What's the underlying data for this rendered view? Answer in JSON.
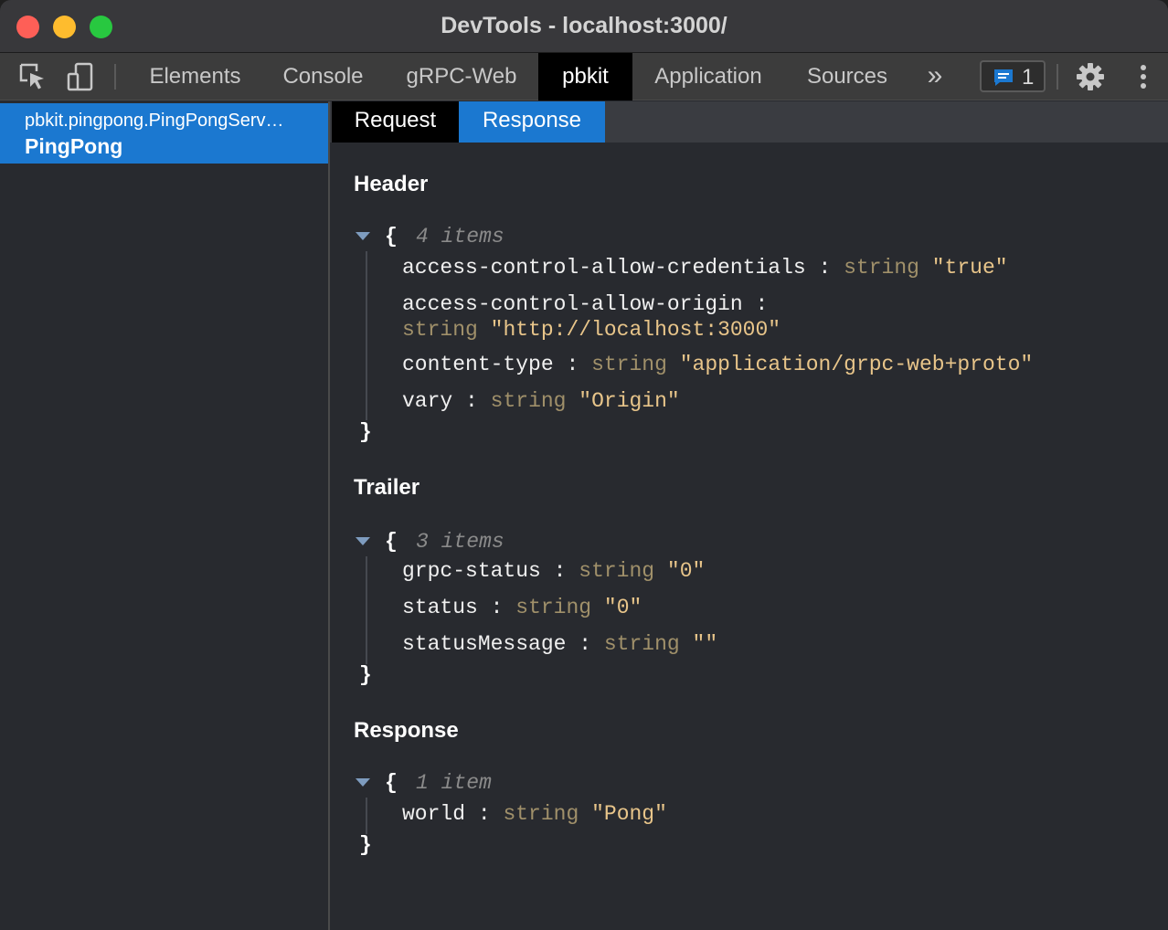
{
  "window": {
    "title": "DevTools - localhost:3000/"
  },
  "toolbar": {
    "tabs": [
      {
        "label": "Elements",
        "active": false
      },
      {
        "label": "Console",
        "active": false
      },
      {
        "label": "gRPC-Web",
        "active": false
      },
      {
        "label": "pbkit",
        "active": true
      },
      {
        "label": "Application",
        "active": false
      },
      {
        "label": "Sources",
        "active": false
      }
    ],
    "more_tabs_label": "»",
    "issues_count": "1"
  },
  "sidebar": {
    "items": [
      {
        "service": "pbkit.pingpong.PingPongServ…",
        "method": "PingPong",
        "selected": true
      }
    ]
  },
  "main": {
    "subtabs": [
      {
        "label": "Request",
        "active": false
      },
      {
        "label": "Response",
        "active": true
      }
    ],
    "sections": {
      "header": {
        "title": "Header",
        "count": "4 items",
        "entries": [
          {
            "key": "access-control-allow-credentials",
            "type": "string",
            "value": "\"true\""
          },
          {
            "key": "access-control-allow-origin",
            "type": "string",
            "value": "\"http://localhost:3000\""
          },
          {
            "key": "content-type",
            "type": "string",
            "value": "\"application/grpc-web+proto\""
          },
          {
            "key": "vary",
            "type": "string",
            "value": "\"Origin\""
          }
        ]
      },
      "trailer": {
        "title": "Trailer",
        "count": "3 items",
        "entries": [
          {
            "key": "grpc-status",
            "type": "string",
            "value": "\"0\""
          },
          {
            "key": "status",
            "type": "string",
            "value": "\"0\""
          },
          {
            "key": "statusMessage",
            "type": "string",
            "value": "\"\""
          }
        ]
      },
      "response": {
        "title": "Response",
        "count": "1 item",
        "entries": [
          {
            "key": "world",
            "type": "string",
            "value": "\"Pong\""
          }
        ]
      }
    }
  },
  "colors": {
    "accent": "#1b78d0",
    "string_type": "#a0906a",
    "string_value": "#e8c58a"
  }
}
